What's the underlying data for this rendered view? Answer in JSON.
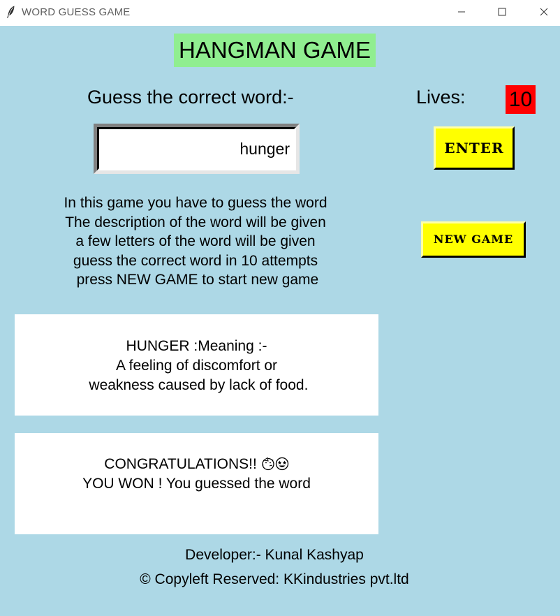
{
  "window": {
    "title": "WORD GUESS GAME",
    "icon": "feather-icon",
    "controls": [
      "minimize-icon",
      "maximize-icon",
      "close-icon"
    ]
  },
  "game": {
    "heading": "HANGMAN GAME",
    "guess_label": "Guess the correct word:-",
    "lives_label": "Lives:",
    "lives_value": "10",
    "guess_input_value": "hunger",
    "enter_button": "ENTER",
    "new_game_button": "NEW GAME",
    "instructions": [
      "In this game you have to guess the word",
      "The description of the word will be given",
      "a few letters of the word will be given",
      "guess the correct word in 10 attempts",
      " press NEW GAME to start new game"
    ],
    "meaning": {
      "line1": "HUNGER :Meaning :-",
      "line2": "A feeling of discomfort or",
      "line3": " weakness caused by lack of food."
    },
    "result": {
      "line1": "CONGRATULATIONS!! ",
      "line2": "YOU WON ! You guessed the word",
      "emojis": [
        "party-face-icon",
        "star-struck-face-icon"
      ]
    },
    "footer": {
      "developer": "Developer:- Kunal Kashyap",
      "copyright": "© Copyleft Reserved: KKindustries pvt.ltd"
    }
  },
  "colors": {
    "background": "#add8e6",
    "heading_bg": "#90ee90",
    "lives_bg": "#ff0000",
    "button_bg": "#ffff00",
    "panel_bg": "#ffffff"
  }
}
